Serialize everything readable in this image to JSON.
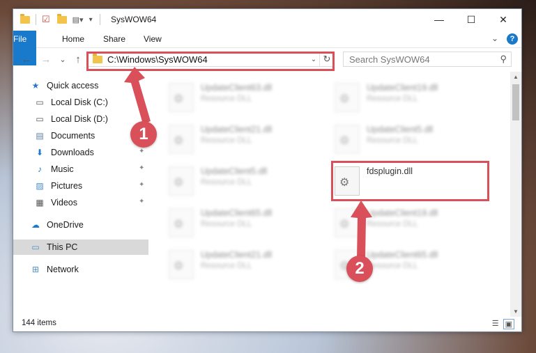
{
  "window": {
    "title": "SysWOW64",
    "minimize": "—",
    "maximize": "☐",
    "close": "✕"
  },
  "ribbon": {
    "tabs": [
      "File",
      "Home",
      "Share",
      "View"
    ],
    "expand": "⌄",
    "help": "?"
  },
  "nav": {
    "back": "←",
    "forward": "→",
    "recent": "⌄",
    "up": "↑",
    "address": "C:\\Windows\\SysWOW64",
    "address_drop": "⌄",
    "refresh": "↻",
    "search_placeholder": "Search SysWOW64",
    "search_icon": "⚲"
  },
  "sidebar": {
    "items": [
      {
        "label": "Quick access",
        "icon": "star-icon",
        "glyph": "★",
        "color": "#2a77c9"
      },
      {
        "label": "Local Disk (C:)",
        "icon": "drive-icon",
        "glyph": "▭",
        "color": "#555555"
      },
      {
        "label": "Local Disk (D:)",
        "icon": "drive-icon",
        "glyph": "▭",
        "color": "#555555"
      },
      {
        "label": "Documents",
        "icon": "documents-icon",
        "glyph": "▤",
        "color": "#5a7fa7"
      },
      {
        "label": "Downloads",
        "icon": "download-icon",
        "glyph": "⬇",
        "color": "#1979ca"
      },
      {
        "label": "Music",
        "icon": "music-icon",
        "glyph": "♪",
        "color": "#1979ca"
      },
      {
        "label": "Pictures",
        "icon": "pictures-icon",
        "glyph": "▨",
        "color": "#4a8fc9"
      },
      {
        "label": "Videos",
        "icon": "videos-icon",
        "glyph": "▦",
        "color": "#555555"
      },
      {
        "label": "OneDrive",
        "icon": "cloud-icon",
        "glyph": "☁",
        "color": "#1979ca"
      },
      {
        "label": "This PC",
        "icon": "computer-icon",
        "glyph": "▭",
        "color": "#4a8fc9"
      },
      {
        "label": "Network",
        "icon": "network-icon",
        "glyph": "⊞",
        "color": "#4a8fc9"
      }
    ],
    "pin": "📌"
  },
  "files": [
    {
      "name": "UpdateClient63.dll",
      "type": "Resource DLL"
    },
    {
      "name": "UpdateClient19.dll",
      "type": "Resource DLL"
    },
    {
      "name": "UpdateClient21.dll",
      "type": "Resource DLL"
    },
    {
      "name": "UpdateClient5.dll",
      "type": "Resource DLL"
    },
    {
      "name": "UpdateClient5.dll",
      "type": "Resource DLL"
    },
    {
      "name": "fdsplugin.dll",
      "type": ""
    },
    {
      "name": "UpdateClient65.dll",
      "type": "Resource DLL"
    },
    {
      "name": "UpdateClient19.dll",
      "type": "Resource DLL"
    },
    {
      "name": "UpdateClient21.dll",
      "type": "Resource DLL"
    },
    {
      "name": "UpdateClient65.dll",
      "type": "Resource DLL"
    }
  ],
  "status": {
    "count": "144 items"
  },
  "callouts": {
    "step1": "1",
    "step2": "2",
    "highlight_color": "#d9505a"
  }
}
